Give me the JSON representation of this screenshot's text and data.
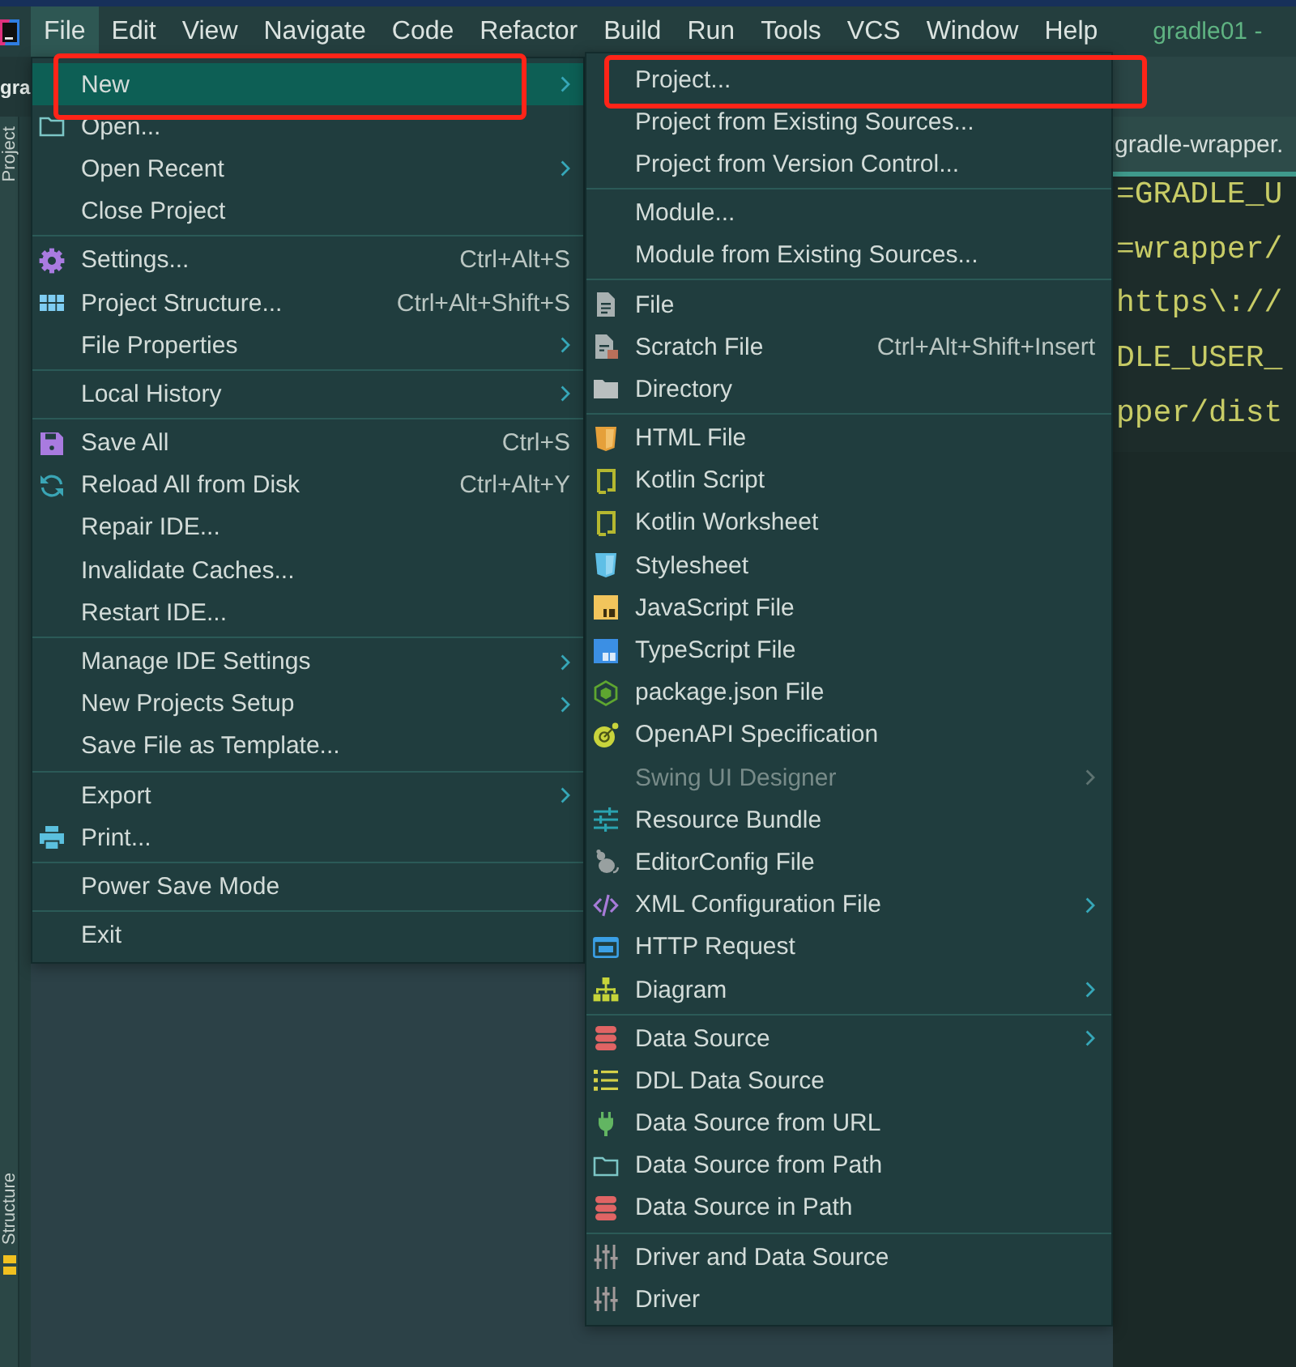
{
  "menu_bar": {
    "items": [
      {
        "label": "File",
        "selected": true
      },
      {
        "label": "Edit",
        "selected": false
      },
      {
        "label": "View",
        "selected": false
      },
      {
        "label": "Navigate",
        "selected": false
      },
      {
        "label": "Code",
        "selected": false
      },
      {
        "label": "Refactor",
        "selected": false
      },
      {
        "label": "Build",
        "selected": false
      },
      {
        "label": "Run",
        "selected": false
      },
      {
        "label": "Tools",
        "selected": false
      },
      {
        "label": "VCS",
        "selected": false
      },
      {
        "label": "Window",
        "selected": false
      },
      {
        "label": "Help",
        "selected": false
      }
    ],
    "title": "gradle01 -"
  },
  "project_panel": {
    "title": "gra"
  },
  "tool_strip": {
    "top_tabs": [
      "Project"
    ],
    "bottom_tabs": [
      "Structure"
    ]
  },
  "editor": {
    "tab": "gradle-wrapper.",
    "lines": [
      "=GRADLE_U",
      "=wrapper/",
      "https\\://",
      "DLE_USER_",
      "pper/dist"
    ]
  },
  "file_menu": {
    "items": [
      {
        "label": "New",
        "kind": "plain",
        "submenu": true,
        "selected": true,
        "disabled": false,
        "annotated": true
      },
      {
        "label": "Open...",
        "kind": "open",
        "submenu": false,
        "selected": false,
        "disabled": false,
        "annotated": false
      },
      {
        "label": "Open Recent",
        "kind": "plain",
        "submenu": true,
        "selected": false,
        "disabled": false,
        "annotated": false
      },
      {
        "label": "Close Project",
        "kind": "plain",
        "submenu": false,
        "selected": false,
        "disabled": false,
        "annotated": false
      },
      {
        "kind": "separator"
      },
      {
        "label": "Settings...",
        "kind": "settings",
        "shortcut": "Ctrl+Alt+S",
        "submenu": false,
        "selected": false,
        "disabled": false,
        "annotated": false
      },
      {
        "label": "Project Structure...",
        "kind": "structure",
        "shortcut": "Ctrl+Alt+Shift+S",
        "submenu": false,
        "selected": false,
        "disabled": false,
        "annotated": false
      },
      {
        "label": "File Properties",
        "kind": "plain",
        "submenu": true,
        "selected": false,
        "disabled": false,
        "annotated": false
      },
      {
        "kind": "separator"
      },
      {
        "label": "Local History",
        "kind": "plain",
        "submenu": true,
        "selected": false,
        "disabled": false,
        "annotated": false
      },
      {
        "kind": "separator"
      },
      {
        "label": "Save All",
        "kind": "save",
        "shortcut": "Ctrl+S",
        "submenu": false,
        "selected": false,
        "disabled": false,
        "annotated": false
      },
      {
        "label": "Reload All from Disk",
        "kind": "reload",
        "shortcut": "Ctrl+Alt+Y",
        "submenu": false,
        "selected": false,
        "disabled": false,
        "annotated": false
      },
      {
        "label": "Repair IDE...",
        "kind": "plain",
        "submenu": false,
        "selected": false,
        "disabled": false,
        "annotated": false
      },
      {
        "label": "Invalidate Caches...",
        "kind": "plain",
        "submenu": false,
        "selected": false,
        "disabled": false,
        "annotated": false
      },
      {
        "label": "Restart IDE...",
        "kind": "plain",
        "submenu": false,
        "selected": false,
        "disabled": false,
        "annotated": false
      },
      {
        "kind": "separator"
      },
      {
        "label": "Manage IDE Settings",
        "kind": "plain",
        "submenu": true,
        "selected": false,
        "disabled": false,
        "annotated": false
      },
      {
        "label": "New Projects Setup",
        "kind": "plain",
        "submenu": true,
        "selected": false,
        "disabled": false,
        "annotated": false
      },
      {
        "label": "Save File as Template...",
        "kind": "plain",
        "submenu": false,
        "selected": false,
        "disabled": false,
        "annotated": false
      },
      {
        "kind": "separator"
      },
      {
        "label": "Export",
        "kind": "plain",
        "submenu": true,
        "selected": false,
        "disabled": false,
        "annotated": false
      },
      {
        "label": "Print...",
        "kind": "print",
        "submenu": false,
        "selected": false,
        "disabled": false,
        "annotated": false
      },
      {
        "kind": "separator"
      },
      {
        "label": "Power Save Mode",
        "kind": "plain",
        "submenu": false,
        "selected": false,
        "disabled": false,
        "annotated": false
      },
      {
        "kind": "separator"
      },
      {
        "label": "Exit",
        "kind": "plain",
        "submenu": false,
        "selected": false,
        "disabled": false,
        "annotated": false
      }
    ]
  },
  "new_menu": {
    "items": [
      {
        "label": "Project...",
        "kind": "plain",
        "submenu": false,
        "selected": false,
        "disabled": false,
        "annotated": true
      },
      {
        "label": "Project from Existing Sources...",
        "kind": "plain",
        "submenu": false,
        "selected": false,
        "disabled": false,
        "annotated": false
      },
      {
        "label": "Project from Version Control...",
        "kind": "plain",
        "submenu": false,
        "selected": false,
        "disabled": false,
        "annotated": false
      },
      {
        "kind": "separator"
      },
      {
        "label": "Module...",
        "kind": "plain",
        "submenu": false,
        "selected": false,
        "disabled": false,
        "annotated": false
      },
      {
        "label": "Module from Existing Sources...",
        "kind": "plain",
        "submenu": false,
        "selected": false,
        "disabled": false,
        "annotated": false
      },
      {
        "kind": "separator"
      },
      {
        "label": "File",
        "kind": "file",
        "submenu": false,
        "selected": false,
        "disabled": false,
        "annotated": false
      },
      {
        "label": "Scratch File",
        "kind": "scratch",
        "shortcut": "Ctrl+Alt+Shift+Insert",
        "submenu": false,
        "selected": false,
        "disabled": false,
        "annotated": false
      },
      {
        "label": "Directory",
        "kind": "directory",
        "submenu": false,
        "selected": false,
        "disabled": false,
        "annotated": false
      },
      {
        "kind": "separator"
      },
      {
        "label": "HTML File",
        "kind": "html",
        "submenu": false,
        "selected": false,
        "disabled": false,
        "annotated": false
      },
      {
        "label": "Kotlin Script",
        "kind": "kotlin",
        "submenu": false,
        "selected": false,
        "disabled": false,
        "annotated": false
      },
      {
        "label": "Kotlin Worksheet",
        "kind": "kotlin",
        "submenu": false,
        "selected": false,
        "disabled": false,
        "annotated": false
      },
      {
        "label": "Stylesheet",
        "kind": "css",
        "submenu": false,
        "selected": false,
        "disabled": false,
        "annotated": false
      },
      {
        "label": "JavaScript File",
        "kind": "javascript",
        "submenu": false,
        "selected": false,
        "disabled": false,
        "annotated": false
      },
      {
        "label": "TypeScript File",
        "kind": "typescript",
        "submenu": false,
        "selected": false,
        "disabled": false,
        "annotated": false
      },
      {
        "label": "package.json File",
        "kind": "package",
        "submenu": false,
        "selected": false,
        "disabled": false,
        "annotated": false
      },
      {
        "label": "OpenAPI Specification",
        "kind": "openapi",
        "submenu": false,
        "selected": false,
        "disabled": false,
        "annotated": false
      },
      {
        "label": "Swing UI Designer",
        "kind": "plain",
        "submenu": true,
        "selected": false,
        "disabled": true,
        "annotated": false
      },
      {
        "label": "Resource Bundle",
        "kind": "bundle",
        "submenu": false,
        "selected": false,
        "disabled": false,
        "annotated": false
      },
      {
        "label": "EditorConfig File",
        "kind": "editorconfig",
        "submenu": false,
        "selected": false,
        "disabled": false,
        "annotated": false
      },
      {
        "label": "XML Configuration File",
        "kind": "xml",
        "submenu": true,
        "selected": false,
        "disabled": false,
        "annotated": false
      },
      {
        "label": "HTTP Request",
        "kind": "http",
        "submenu": false,
        "selected": false,
        "disabled": false,
        "annotated": false
      },
      {
        "label": "Diagram",
        "kind": "diagram",
        "submenu": true,
        "selected": false,
        "disabled": false,
        "annotated": false
      },
      {
        "kind": "separator"
      },
      {
        "label": "Data Source",
        "kind": "datasource",
        "submenu": true,
        "selected": false,
        "disabled": false,
        "annotated": false
      },
      {
        "label": "DDL Data Source",
        "kind": "ddl",
        "submenu": false,
        "selected": false,
        "disabled": false,
        "annotated": false
      },
      {
        "label": "Data Source from URL",
        "kind": "url",
        "submenu": false,
        "selected": false,
        "disabled": false,
        "annotated": false
      },
      {
        "label": "Data Source from Path",
        "kind": "path",
        "submenu": false,
        "selected": false,
        "disabled": false,
        "annotated": false
      },
      {
        "label": "Data Source in Path",
        "kind": "datasource",
        "submenu": false,
        "selected": false,
        "disabled": false,
        "annotated": false
      },
      {
        "kind": "separator"
      },
      {
        "label": "Driver and Data Source",
        "kind": "driver",
        "submenu": false,
        "selected": false,
        "disabled": false,
        "annotated": false
      },
      {
        "label": "Driver",
        "kind": "driver",
        "submenu": false,
        "selected": false,
        "disabled": false,
        "annotated": false
      }
    ]
  }
}
